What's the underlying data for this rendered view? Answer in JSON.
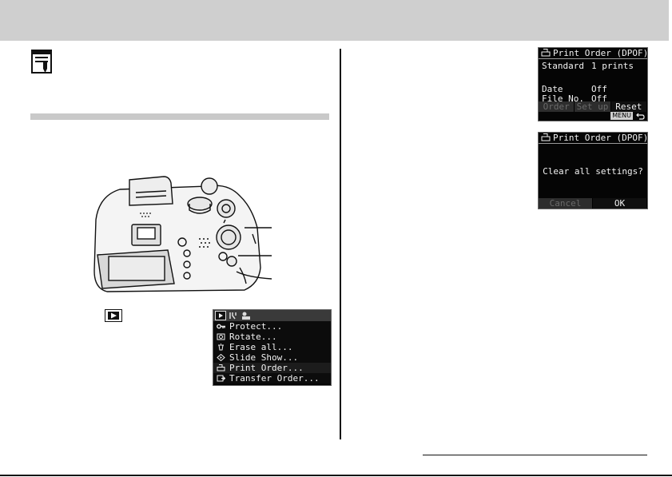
{
  "print_order_screen": {
    "title": "Print Order (DPOF)",
    "rows": [
      {
        "label": "Standard",
        "value": "1 prints"
      },
      {
        "label": "Date",
        "value": "Off"
      },
      {
        "label": "File No.",
        "value": "Off"
      }
    ],
    "buttons": [
      "Order",
      "Set up",
      "Reset"
    ],
    "active_button": "Reset",
    "menu_badge": "MENU"
  },
  "clear_screen": {
    "title": "Print Order (DPOF)",
    "question": "Clear all settings?",
    "buttons": [
      "Cancel",
      "OK"
    ],
    "active_button": "OK"
  },
  "playback_menu": {
    "tabs": [
      "playback-tab-icon",
      "tools-tab-icon",
      "my-camera-tab-icon"
    ],
    "items": [
      {
        "label": "Protect...",
        "icon": "key-icon"
      },
      {
        "label": "Rotate...",
        "icon": "rotate-icon"
      },
      {
        "label": "Erase all...",
        "icon": "trash-icon"
      },
      {
        "label": "Slide Show...",
        "icon": "slideshow-icon"
      },
      {
        "label": "Print Order...",
        "icon": "printer-icon"
      },
      {
        "label": "Transfer Order...",
        "icon": "transfer-icon"
      }
    ],
    "selected": "Print Order..."
  },
  "colors": {
    "header_band": "#cfcfcf",
    "lcd_background": "#050505",
    "lcd_text": "#f2f2f2",
    "disabled_button": "#6a6a6a"
  }
}
